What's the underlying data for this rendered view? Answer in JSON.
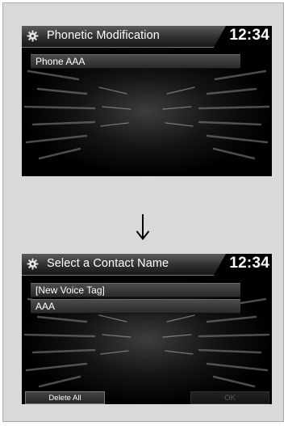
{
  "screen_top": {
    "title": "Phonetic Modification",
    "clock": "12:34",
    "items": [
      "Phone AAA"
    ]
  },
  "screen_bottom": {
    "title": "Select a Contact Name",
    "clock": "12:34",
    "items": [
      "[New Voice Tag]",
      "AAA"
    ],
    "buttons": {
      "delete_all": "Delete All",
      "ok": "OK"
    }
  },
  "icons": {
    "title_icon": "gear-icon",
    "transition": "arrow-down-icon"
  },
  "colors": {
    "screen_background": "#000000",
    "text": "#ffffff",
    "panel_background": "#d9d9d9",
    "disabled_text": "#555555"
  }
}
